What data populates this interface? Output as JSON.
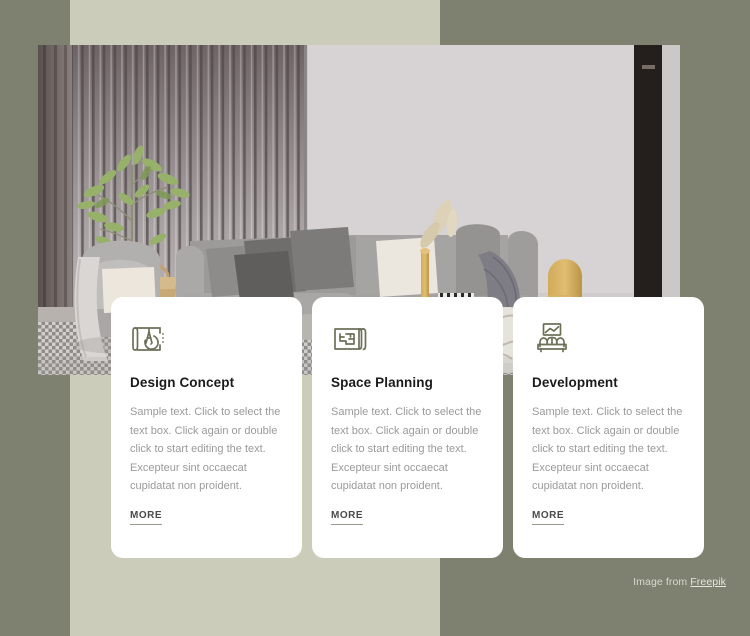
{
  "page": {
    "background_color": "#7e8170",
    "panel_color": "#ccccba"
  },
  "hero": {
    "name": "living-room-interior-photo",
    "alt": "Modern living room with grey sofa, olive tree, gold lamp and knitted pouf"
  },
  "cards": [
    {
      "icon": "blueprint-compass-icon",
      "title": "Design Concept",
      "body": "Sample text. Click to select the text box. Click again or double click to start editing the text. Excepteur sint occaecat cupidatat non proident.",
      "more_label": "MORE"
    },
    {
      "icon": "floor-plan-icon",
      "title": "Space Planning",
      "body": "Sample text. Click to select the text box. Click again or double click to start editing the text. Excepteur sint occaecat cupidatat non proident.",
      "more_label": "MORE"
    },
    {
      "icon": "sofa-picture-frame-icon",
      "title": "Development",
      "body": "Sample text. Click to select the text box. Click again or double click to start editing the text. Excepteur sint occaecat cupidatat non proident.",
      "more_label": "MORE"
    }
  ],
  "attribution": {
    "prefix": "Image from ",
    "link_label": "Freepik"
  },
  "colors": {
    "icon_stroke": "#6d7059",
    "title": "#1b1b1b",
    "body": "#9a9a9a",
    "more": "#4a4a4a"
  }
}
